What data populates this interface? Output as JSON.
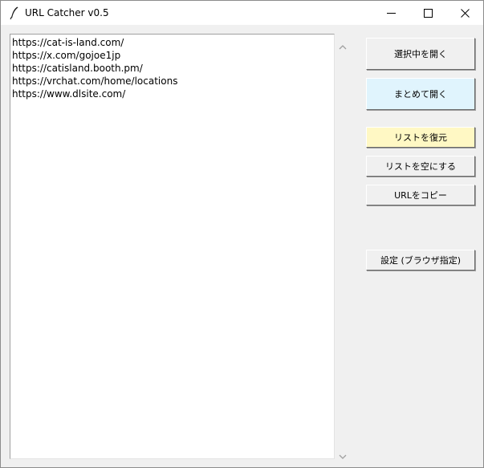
{
  "window": {
    "title": "URL Catcher v0.5"
  },
  "url_list": {
    "items": [
      "https://cat-is-land.com/",
      "https://x.com/gojoe1jp",
      "https://catisland.booth.pm/",
      "https://vrchat.com/home/locations",
      "https://www.dlsite.com/"
    ]
  },
  "buttons": {
    "open_selected": "選択中を開く",
    "open_all": "まとめて開く",
    "restore_list": "リストを復元",
    "clear_list": "リストを空にする",
    "copy_url": "URLをコピー",
    "settings": "設定 (ブラウザ指定)"
  },
  "colors": {
    "open_all_bg": "#e0f4fd",
    "restore_bg": "#fff8c4",
    "window_bg": "#f0f0f0"
  },
  "icons": {
    "app": "feather-icon",
    "minimize": "minimize-icon",
    "maximize": "maximize-icon",
    "close": "close-icon"
  }
}
